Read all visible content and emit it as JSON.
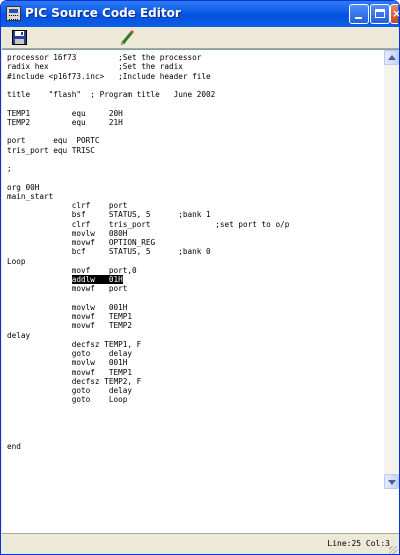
{
  "window": {
    "title": "PIC Source Code Editor",
    "close_glyph": "×"
  },
  "toolbar": {
    "buttons": [
      {
        "name": "save",
        "icon": "floppy-disk-icon"
      },
      {
        "name": "edit",
        "icon": "pencil-icon"
      }
    ]
  },
  "editor": {
    "lines": [
      "processor 16f73         ;Set the processor",
      "radix hex               ;Set the radix",
      "#include <p16f73.inc>   ;Include header file",
      "",
      "title    \"flash\"  ; Program title   June 2002",
      "",
      "TEMP1         equ     20H",
      "TEMP2         equ     21H",
      "",
      "port      equ  PORTC",
      "tris_port equ TRISC",
      "",
      ";",
      "",
      "org 00H",
      "main_start",
      "              clrf    port",
      "              bsf     STATUS, 5      ;bank 1",
      "              clrf    tris_port              ;set port to o/p",
      "              movlw   080H",
      "              movwf   OPTION_REG",
      "              bcf     STATUS, 5      ;bank 0",
      "Loop",
      "              movf    port,0",
      "              addlw   01H",
      "              movwf   port",
      "",
      "              movlw   001H",
      "              movwf   TEMP1",
      "              movwf   TEMP2",
      "delay",
      "              decfsz TEMP1, F",
      "              goto    delay",
      "              movlw   001H",
      "              movwf   TEMP1",
      "              decfsz TEMP2, F",
      "              goto    delay",
      "              goto    Loop",
      "",
      "",
      "",
      "",
      "end"
    ],
    "highlight": {
      "line": 25,
      "prefix": "              ",
      "text": "addlw   01H"
    }
  },
  "status": {
    "cursor": "Line:25 Col:3"
  },
  "colors": {
    "titlebar": "#0b5be7",
    "window_face": "#ece9d8",
    "selection": "#000000"
  }
}
